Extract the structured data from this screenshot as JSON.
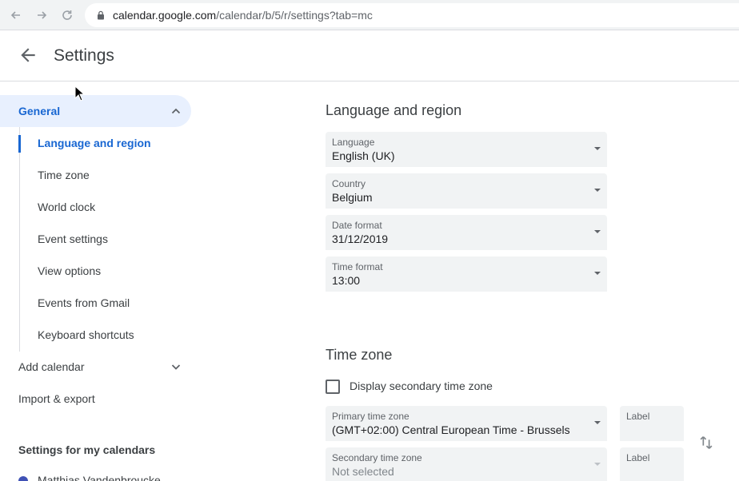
{
  "browser": {
    "url_host": "calendar.google.com",
    "url_path": "/calendar/b/5/r/settings?tab=mc"
  },
  "header": {
    "title": "Settings"
  },
  "sidebar": {
    "general_label": "General",
    "general_items": [
      "Language and region",
      "Time zone",
      "World clock",
      "Event settings",
      "View options",
      "Events from Gmail",
      "Keyboard shortcuts"
    ],
    "add_calendar": "Add calendar",
    "import_export": "Import & export",
    "my_calendars_heading": "Settings for my calendars",
    "calendars": [
      "Matthias Vandenbroucke"
    ]
  },
  "language_region": {
    "title": "Language and region",
    "language": {
      "label": "Language",
      "value": "English (UK)"
    },
    "country": {
      "label": "Country",
      "value": "Belgium"
    },
    "date_format": {
      "label": "Date format",
      "value": "31/12/2019"
    },
    "time_format": {
      "label": "Time format",
      "value": "13:00"
    }
  },
  "time_zone": {
    "title": "Time zone",
    "secondary_checkbox_label": "Display secondary time zone",
    "secondary_enabled": false,
    "primary": {
      "label": "Primary time zone",
      "value": "(GMT+02:00) Central European Time - Brussels"
    },
    "primary_label_field": "Label",
    "secondary": {
      "label": "Secondary time zone",
      "value": "Not selected"
    },
    "secondary_label_field": "Label"
  },
  "colors": {
    "accent": "#1967d2",
    "active_bg": "#e8f0fe",
    "field_bg": "#f1f3f4",
    "calendar_dot": "#3f51b5"
  }
}
